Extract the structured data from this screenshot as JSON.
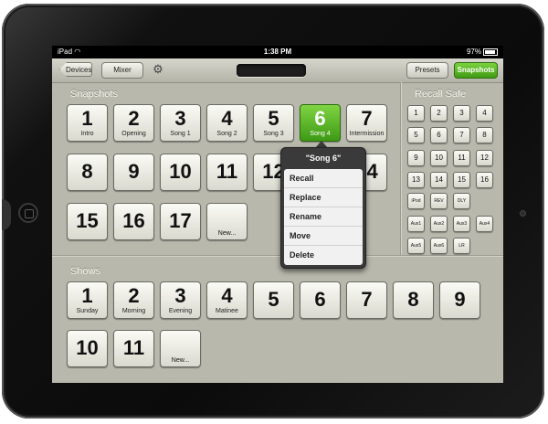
{
  "status": {
    "carrier": "iPad",
    "time": "1:38 PM",
    "battery": "97%"
  },
  "toolbar": {
    "back_label": "Devices",
    "mixer_label": "Mixer",
    "presets_label": "Presets",
    "snapshots_label": "Snapshots"
  },
  "snapshots": {
    "title": "Snapshots",
    "tiles": [
      {
        "num": "1",
        "name": "Intro"
      },
      {
        "num": "2",
        "name": "Opening"
      },
      {
        "num": "3",
        "name": "Song 1"
      },
      {
        "num": "4",
        "name": "Song 2"
      },
      {
        "num": "5",
        "name": "Song 3"
      },
      {
        "num": "6",
        "name": "Song 4"
      },
      {
        "num": "7",
        "name": "Intermission"
      },
      {
        "num": "8",
        "name": ""
      },
      {
        "num": "9",
        "name": ""
      },
      {
        "num": "10",
        "name": ""
      },
      {
        "num": "11",
        "name": ""
      },
      {
        "num": "12",
        "name": ""
      },
      {
        "num": "14",
        "name": ""
      },
      {
        "num": "15",
        "name": ""
      },
      {
        "num": "16",
        "name": ""
      },
      {
        "num": "17",
        "name": ""
      }
    ],
    "new_label": "New..."
  },
  "recall_safe": {
    "title": "Recall Safe",
    "buttons": [
      "1",
      "2",
      "3",
      "4",
      "5",
      "6",
      "7",
      "8",
      "9",
      "10",
      "11",
      "12",
      "13",
      "14",
      "15",
      "16",
      "iPod",
      "REV",
      "DLY",
      "Aux1",
      "Aux2",
      "Aux3",
      "Aux4",
      "Aux5",
      "Aux6",
      "LR"
    ]
  },
  "context_menu": {
    "title": "\"Song 6\"",
    "items": [
      "Recall",
      "Replace",
      "Rename",
      "Move",
      "Delete"
    ]
  },
  "shows": {
    "title": "Shows",
    "tiles": [
      {
        "num": "1",
        "name": "Sunday"
      },
      {
        "num": "2",
        "name": "Morning"
      },
      {
        "num": "3",
        "name": "Evening"
      },
      {
        "num": "4",
        "name": "Matinee"
      },
      {
        "num": "5",
        "name": ""
      },
      {
        "num": "6",
        "name": ""
      },
      {
        "num": "7",
        "name": ""
      },
      {
        "num": "8",
        "name": ""
      },
      {
        "num": "9",
        "name": ""
      },
      {
        "num": "10",
        "name": ""
      },
      {
        "num": "11",
        "name": ""
      }
    ],
    "new_label": "New..."
  },
  "colors": {
    "accent_green": "#4caf1e",
    "panel": "#b8b8ad"
  }
}
